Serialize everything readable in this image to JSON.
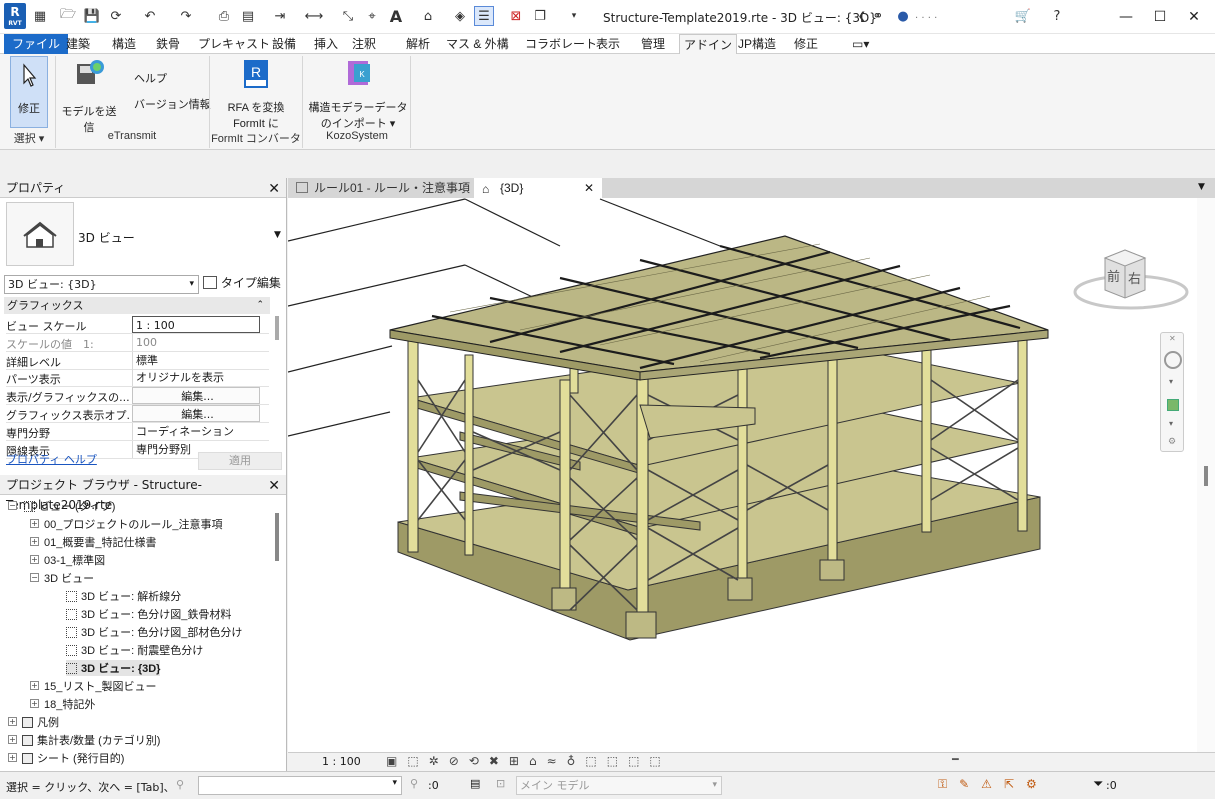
{
  "titlebar": {
    "app_icon_label": "R",
    "app_icon_sub": "RVT",
    "document_title": "Structure-Template2019.rte - 3D ビュー: {3D}",
    "user_name": ". . . .",
    "icons": [
      "open-icon",
      "save-icon",
      "sync-icon",
      "undo-icon",
      "redo-icon",
      "print-icon",
      "pdf-icon",
      "dimension-icon",
      "measure-icon",
      "text-icon",
      "3d-view-icon",
      "section-icon",
      "thin-lines-icon",
      "close-hidden-icon",
      "switch-windows-icon",
      "binoculars-icon",
      "user-icon",
      "cart-icon",
      "help-icon"
    ]
  },
  "tabs": [
    "ファイル",
    "建築",
    "構造",
    "鉄骨",
    "プレキャスト",
    "設備",
    "挿入",
    "注釈",
    "解析",
    "マス & 外構",
    "コラボレート",
    "表示",
    "管理",
    "アドイン",
    "JP構造",
    "修正"
  ],
  "active_tab": "アドイン",
  "ribbon": {
    "modify_label": "修正",
    "select_panel": "選択",
    "send_model_label": "モデルを送信",
    "help_label": "ヘルプ",
    "version_label": "バージョン情報",
    "etransmit_panel": "eTransmit",
    "rfa_label_1": "RFA を変換",
    "rfa_label_2": "FormIt に",
    "formit_panel": "FormIt コンバータ",
    "kozo_label_1": "構造モデラーデータ",
    "kozo_label_2": "のインポート",
    "kozo_panel": "KozoSystem"
  },
  "properties": {
    "title": "プロパティ",
    "type_name": "3D ビュー",
    "selector_value": "3D ビュー: {3D}",
    "edit_type_label": "タイプ編集",
    "section_graphics": "グラフィックス",
    "rows": [
      {
        "key": "ビュー スケール",
        "value": "1 : 100"
      },
      {
        "key": "スケールの値　1:",
        "value": "100"
      },
      {
        "key": "詳細レベル",
        "value": "標準"
      },
      {
        "key": "パーツ表示",
        "value": "オリジナルを表示"
      },
      {
        "key": "表示/グラフィックスの...",
        "value": "編集..."
      },
      {
        "key": "グラフィックス表示オプ...",
        "value": "編集..."
      },
      {
        "key": "専門分野",
        "value": "コーディネーション"
      },
      {
        "key": "隠線表示",
        "value": "専門分野別"
      }
    ],
    "help_link": "プロパティ ヘルプ",
    "apply_label": "適用"
  },
  "browser": {
    "title": "プロジェクト ブラウザ - Structure-Template2019.rte",
    "items": [
      {
        "label": "ビュー (タイプ)"
      },
      {
        "label": "00_プロジェクトのルール_注意事項"
      },
      {
        "label": "01_概要書_特記仕様書"
      },
      {
        "label": "03-1_標準図"
      },
      {
        "label": "3D ビュー"
      },
      {
        "label": "3D ビュー: 解析線分"
      },
      {
        "label": "3D ビュー: 色分け図_鉄骨材料"
      },
      {
        "label": "3D ビュー: 色分け図_部材色分け"
      },
      {
        "label": "3D ビュー: 耐震壁色分け"
      },
      {
        "label": "3D ビュー: {3D}"
      },
      {
        "label": "15_リスト_製図ビュー"
      },
      {
        "label": "18_特記外"
      },
      {
        "label": "凡例"
      },
      {
        "label": "集計表/数量 (カテゴリ別)"
      },
      {
        "label": "シート (発行目的)"
      }
    ]
  },
  "view_tabs": [
    {
      "label": "ルール01 - ルール・注意事項"
    },
    {
      "label": "{3D}"
    }
  ],
  "viewcube": {
    "front": "前",
    "right": "右"
  },
  "view_bar": {
    "scale": "1 : 100"
  },
  "status": {
    "message": "選択 = クリック、次へ = [Tab]、追加",
    "selection_count": ":0",
    "model_label": "メイン モデル",
    "filter_count": ":0"
  },
  "colors": {
    "accent": "#1c6bc9",
    "structure_fill": "#c9c58f",
    "structure_face": "#d9d5a0",
    "structure_shadow": "#9e9a66"
  }
}
